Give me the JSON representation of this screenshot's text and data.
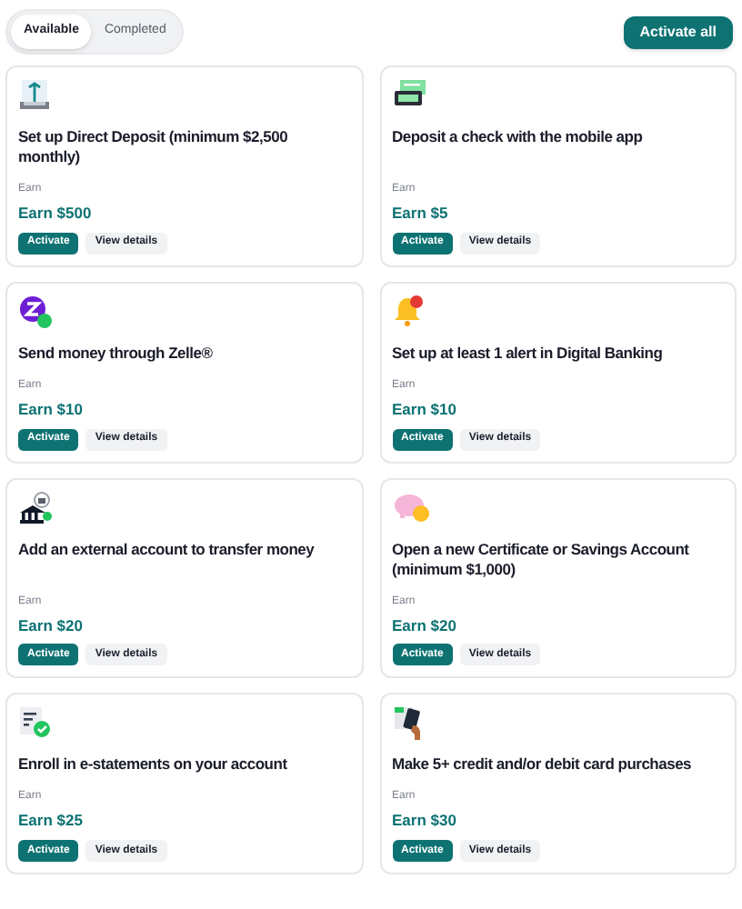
{
  "tabs": [
    {
      "label": "Available",
      "selected": true
    },
    {
      "label": "Completed",
      "selected": false
    }
  ],
  "activate_all": "Activate all",
  "tasks": [
    {
      "kind": "deposit",
      "title": "Set up Direct Deposit (minimum $2,500 monthly)",
      "earn_label": "Earn",
      "reward": "Earn $500",
      "activate": "Activate",
      "details": "View details"
    },
    {
      "kind": "check",
      "title": "Deposit a check with the mobile app",
      "earn_label": "Earn",
      "reward": "Earn $5",
      "activate": "Activate",
      "details": "View details"
    },
    {
      "kind": "zelle",
      "title": "Send money through Zelle®",
      "earn_label": "Earn",
      "reward": "Earn $10",
      "activate": "Activate",
      "details": "View details"
    },
    {
      "kind": "alert",
      "title": "Set up at least 1 alert in Digital Banking",
      "earn_label": "Earn",
      "reward": "Earn $10",
      "activate": "Activate",
      "details": "View details"
    },
    {
      "kind": "bank",
      "title": "Add an external account to transfer money",
      "earn_label": "Earn",
      "reward": "Earn $20",
      "activate": "Activate",
      "details": "View details"
    },
    {
      "kind": "savings",
      "title": "Open a new Certificate or Savings Account (minimum $1,000)",
      "earn_label": "Earn",
      "reward": "Earn $20",
      "activate": "Activate",
      "details": "View details"
    },
    {
      "kind": "statement",
      "title": "Enroll in e-statements on your account",
      "earn_label": "Earn",
      "reward": "Earn $25",
      "activate": "Activate",
      "details": "View details"
    },
    {
      "kind": "card",
      "title": "Make 5+ credit and/or debit card purchases",
      "earn_label": "Earn",
      "reward": "Earn $30",
      "activate": "Activate",
      "details": "View details"
    }
  ]
}
